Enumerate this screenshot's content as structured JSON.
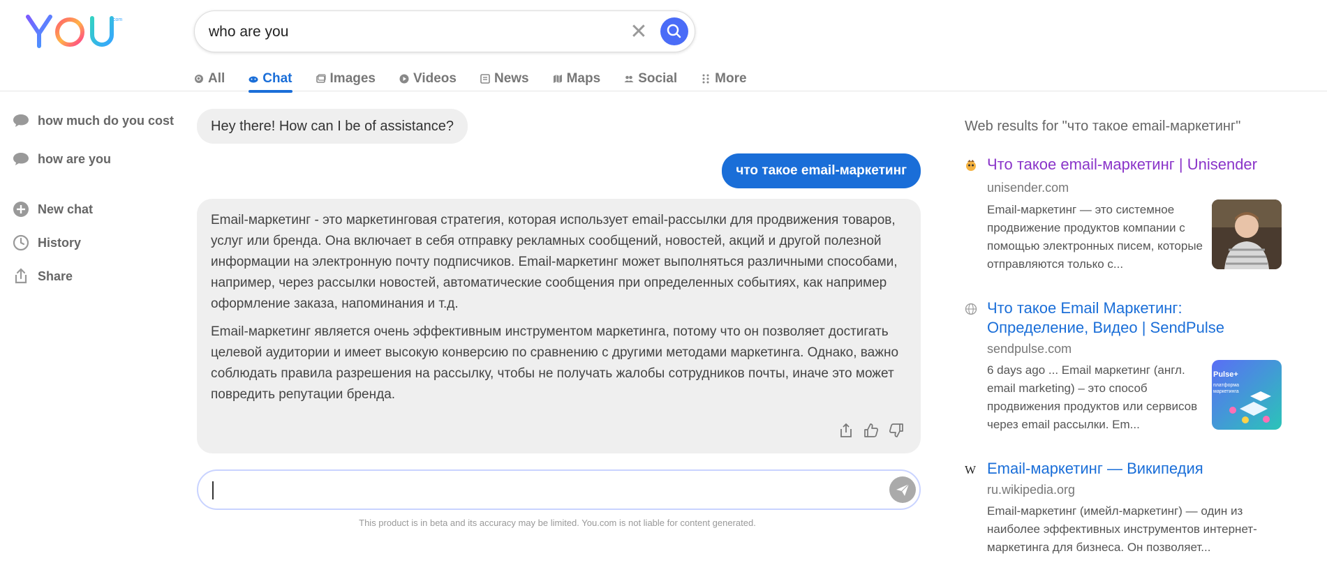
{
  "search": {
    "query": "who are you",
    "clear_label": "✕"
  },
  "tabs": [
    {
      "label": "All",
      "icon": "search-icon"
    },
    {
      "label": "Chat",
      "icon": "chat-icon",
      "active": true
    },
    {
      "label": "Images",
      "icon": "images-icon"
    },
    {
      "label": "Videos",
      "icon": "play-icon"
    },
    {
      "label": "News",
      "icon": "news-icon"
    },
    {
      "label": "Maps",
      "icon": "map-icon"
    },
    {
      "label": "Social",
      "icon": "people-icon"
    },
    {
      "label": "More",
      "icon": "dots-grid-icon"
    }
  ],
  "sidebar": {
    "history_chats": [
      {
        "label": "how much do you cost"
      },
      {
        "label": "how are you"
      }
    ],
    "actions": [
      {
        "label": "New chat",
        "icon": "plus-circle-icon"
      },
      {
        "label": "History",
        "icon": "clock-icon"
      },
      {
        "label": "Share",
        "icon": "share-icon"
      }
    ]
  },
  "chat": {
    "greeting": "Hey there! How can I be of assistance?",
    "user_message": "что такое email-маркетинг",
    "answer_paragraphs": [
      "Email-маркетинг - это маркетинговая стратегия, которая использует email-рассылки для продвижения товаров, услуг или бренда. Она включает в себя отправку рекламных сообщений, новостей, акций и другой полезной информации на электронную почту подписчиков. Email-маркетинг может выполняться различными способами, например, через рассылки новостей, автоматические сообщения при определенных событиях, как например оформление заказа, напоминания и т.д.",
      "Email-маркетинг является очень эффективным инструментом маркетинга, потому что он позволяет достигать целевой аудитории и имеет высокую конверсию по сравнению с другими методами маркетинга. Однако, важно соблюдать правила разрешения на рассылку, чтобы не получать жалобы сотрудников почты, иначе это может повредить репутации бренда."
    ],
    "input_value": "",
    "disclaimer": "This product is in beta and its accuracy may be limited. You.com is not liable for content generated."
  },
  "web": {
    "title": "Web results for \"что такое email-маркетинг\"",
    "results": [
      {
        "title": "Что такое email-маркетинг | Unisender",
        "url": "unisender.com",
        "desc": "Email-маркетинг — это системное продвижение продуктов компании с помощью электронных писем, которые отправляются только с...",
        "visited": true
      },
      {
        "title": "Что такое Email Маркетинг: Определение, Видео | SendPulse",
        "url": "sendpulse.com",
        "desc": "6 days ago ... Email маркетинг (англ. email marketing) – это способ продвижения продуктов или сервисов через email рассылки. Em...",
        "thumb_text": "Pulse+\nплатформа\nмаркетинга"
      },
      {
        "title": "Email-маркетинг — Википедия",
        "url": "ru.wikipedia.org",
        "desc": "Email-маркетинг (имейл-маркетинг) — один из наиболее эффективных инструментов интернет-маркетинга для бизнеса. Он позволяет..."
      }
    ]
  },
  "colors": {
    "accent": "#1a6ed8",
    "search_button": "#4a6cf7",
    "visited_link": "#8a34c9",
    "bubble_bg": "#efefef"
  }
}
